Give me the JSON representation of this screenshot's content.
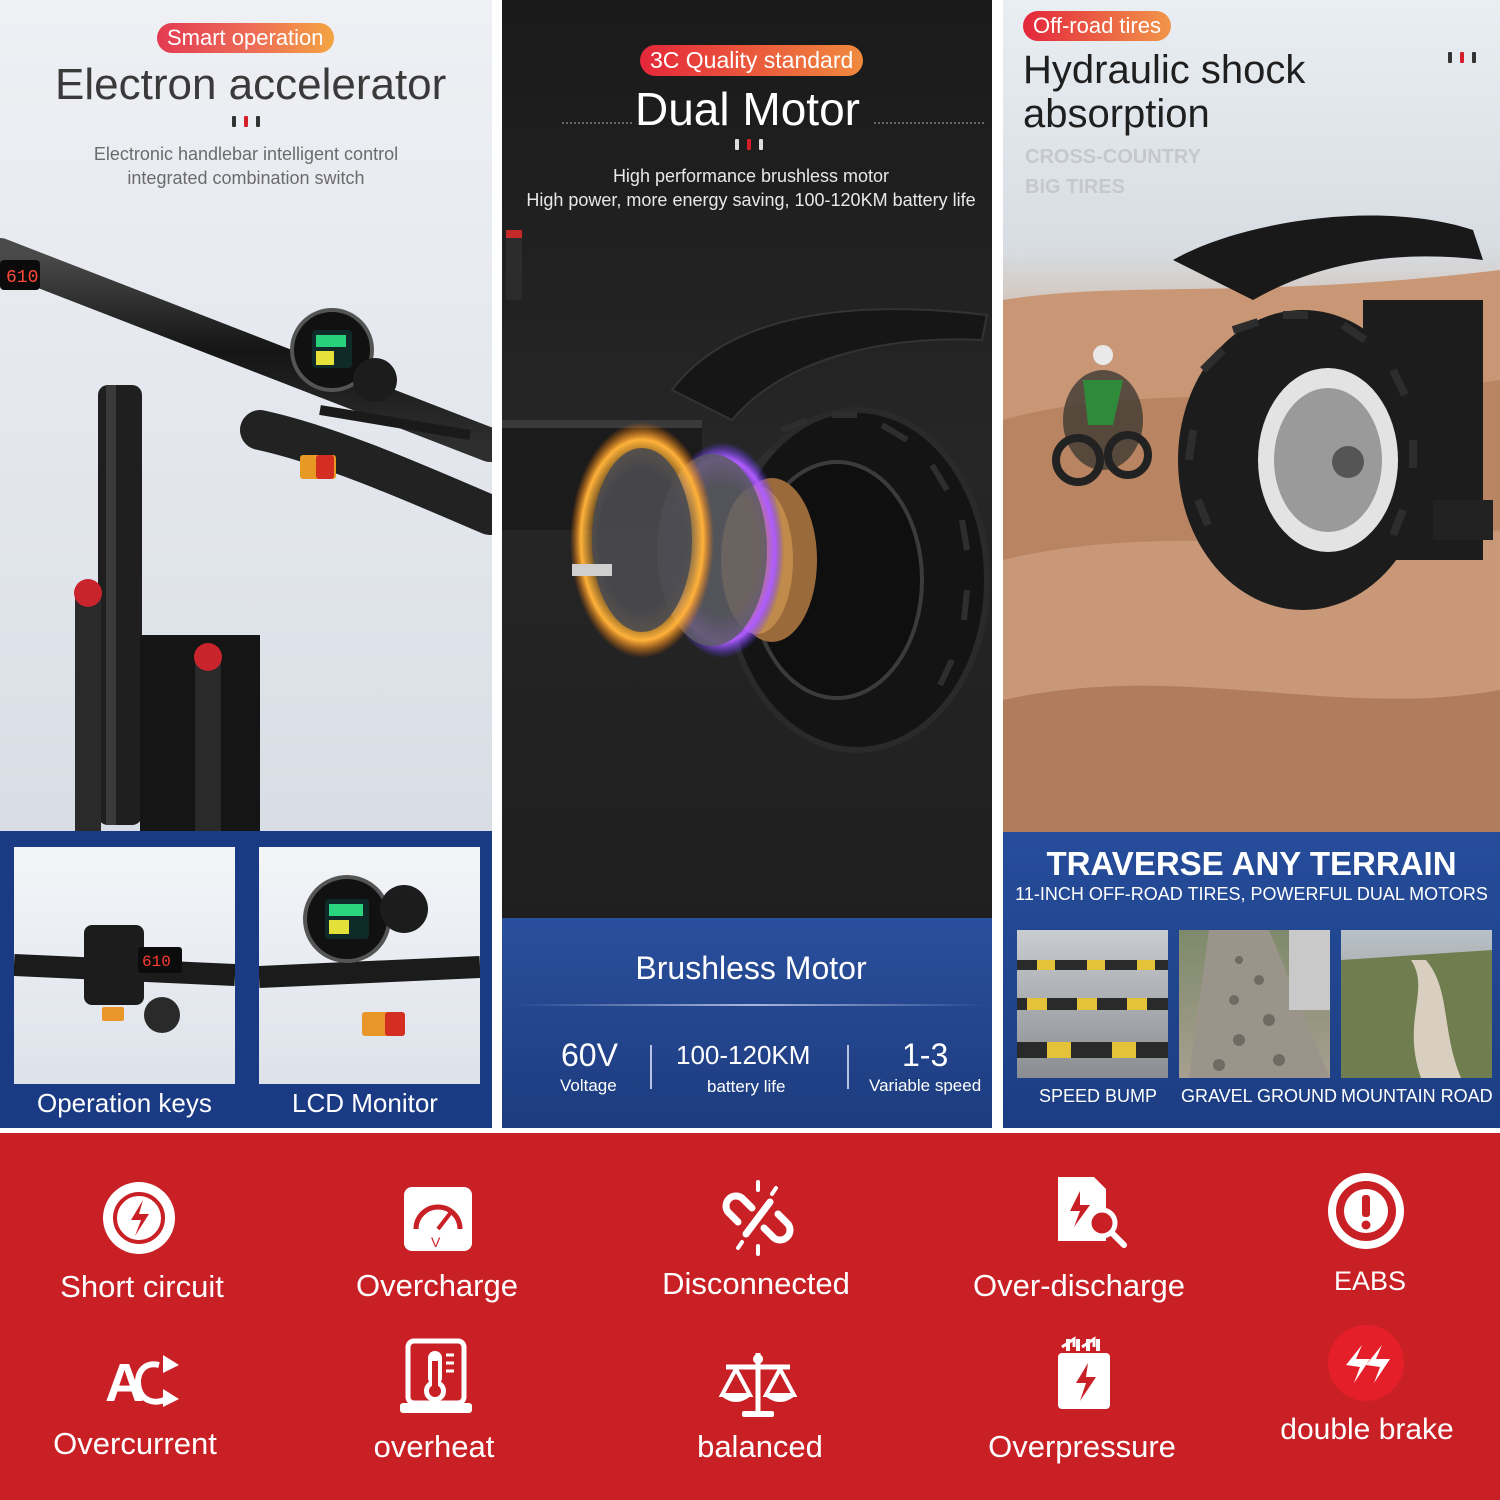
{
  "panel_smart": {
    "tag": "Smart operation",
    "title": "Electron accelerator",
    "desc_line1": "Electronic handlebar intelligent control",
    "desc_line2": "integrated combination switch",
    "lcd_readout": "610",
    "thumbs": [
      {
        "label": "Operation keys"
      },
      {
        "label": "LCD Monitor"
      }
    ]
  },
  "panel_motor": {
    "tag": "3C Quality standard",
    "title": "Dual Motor",
    "desc_line1": "High performance brushless motor",
    "desc_line2": "High power, more energy saving, 100-120KM battery life",
    "bottom_title": "Brushless Motor",
    "stats": [
      {
        "value": "60V",
        "label": "Voltage"
      },
      {
        "value": "100-120KM",
        "label": "battery life"
      },
      {
        "value": "1-3",
        "label": "Variable speed"
      }
    ]
  },
  "panel_tires": {
    "tag": "Off-road tires",
    "title_line1": "Hydraulic shock",
    "title_line2": "absorption",
    "watermark_line1": "CROSS-COUNTRY",
    "watermark_line2": "BIG TIRES",
    "bottom_title": "TRAVERSE ANY TERRAIN",
    "bottom_sub": "11-INCH OFF-ROAD TIRES, POWERFUL DUAL MOTORS",
    "terrains": [
      {
        "label": "SPEED BUMP"
      },
      {
        "label": "GRAVEL GROUND"
      },
      {
        "label": "MOUNTAIN ROAD"
      }
    ]
  },
  "features": [
    {
      "label": "Short circuit",
      "icon": "short-circuit-icon"
    },
    {
      "label": "Overcharge",
      "icon": "overcharge-gauge-icon"
    },
    {
      "label": "Disconnected",
      "icon": "broken-link-icon"
    },
    {
      "label": "Over-discharge",
      "icon": "battery-search-icon"
    },
    {
      "label": "EABS",
      "icon": "brake-warning-icon"
    },
    {
      "label": "Overcurrent",
      "icon": "ac-arrow-icon"
    },
    {
      "label": "overheat",
      "icon": "thermometer-icon"
    },
    {
      "label": "balanced",
      "icon": "balance-scale-icon"
    },
    {
      "label": "Overpressure",
      "icon": "pressure-battery-icon"
    },
    {
      "label": "double brake",
      "icon": "double-brake-icon"
    }
  ],
  "colors": {
    "feature_background": "#c92026",
    "brand_blue": "#1d3c7f",
    "pill_gradient_start": "#e33b52",
    "pill_gradient_end": "#f4a542"
  }
}
